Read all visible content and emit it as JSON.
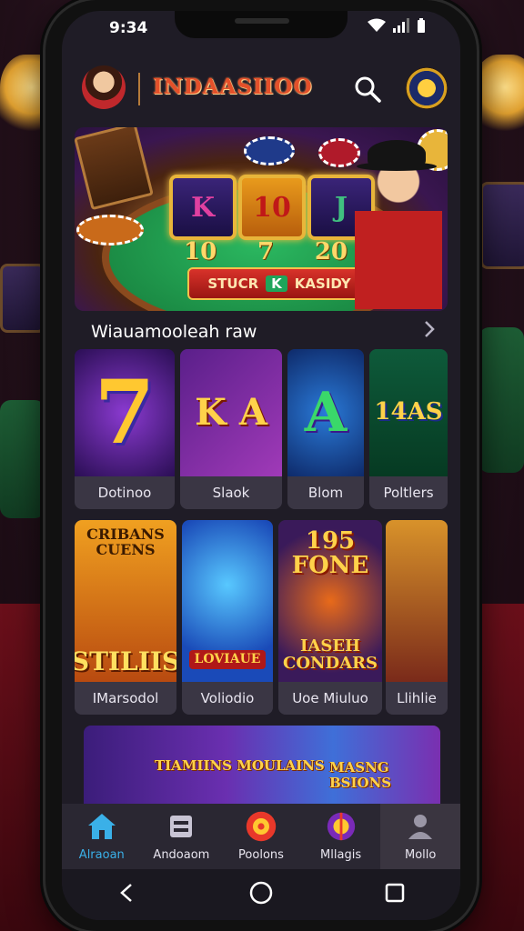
{
  "status_bar": {
    "time": "9:34"
  },
  "header": {
    "brand": "INDAASIIOO"
  },
  "hero": {
    "reels": [
      "K",
      "10",
      "J"
    ],
    "numbers": [
      "10",
      "7",
      "20"
    ],
    "button": {
      "left": "STUCR",
      "mid": "K",
      "right": "KASIDY"
    }
  },
  "section": {
    "title": "Wiauamooleah raw"
  },
  "games_row1": [
    {
      "label": "Dotinoo",
      "art": "7"
    },
    {
      "label": "Slaok",
      "art": "K A"
    },
    {
      "label": "Blom",
      "art": "A"
    },
    {
      "label": "Poltlers",
      "art": "14AS"
    }
  ],
  "games_row2": [
    {
      "label": "IMarsodol",
      "art_top": "CRIBANS CUENS",
      "art_bottom": "STILIIS"
    },
    {
      "label": "Voliodio",
      "art_top": "",
      "art_bottom": "LOVIAUE"
    },
    {
      "label": "Uoe Miuluo",
      "art_top": "195 FONE",
      "art_bottom": "IASEH CONDARS"
    },
    {
      "label": "Llihlie",
      "art_top": "",
      "art_bottom": ""
    }
  ],
  "promo": {
    "left_text": "TIAMIINS MOULAINS",
    "right_text": "MASNG BSIONS"
  },
  "bottom_nav": [
    {
      "label": "Alraoan",
      "icon": "home-icon"
    },
    {
      "label": "Andoaom",
      "icon": "film-icon"
    },
    {
      "label": "Poolons",
      "icon": "roulette-icon"
    },
    {
      "label": "Mllagis",
      "icon": "chip-icon"
    },
    {
      "label": "Mollo",
      "icon": "profile-icon"
    }
  ],
  "colors": {
    "accent": "#3ab0e8",
    "brand": "#e4502a",
    "gold": "#e8b53a"
  }
}
